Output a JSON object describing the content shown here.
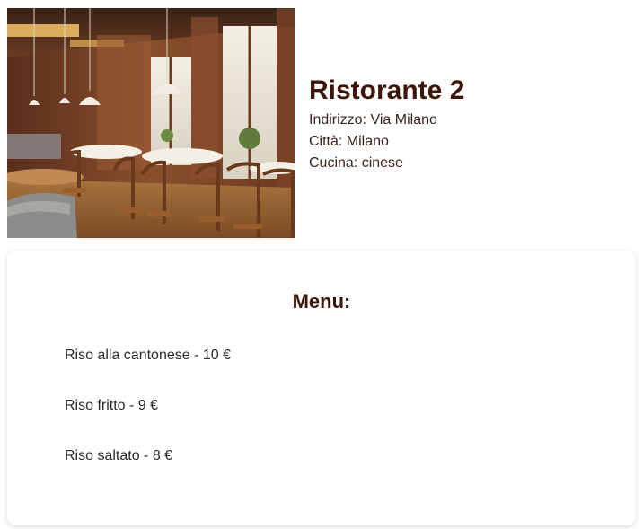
{
  "restaurant": {
    "name": "Ristorante 2",
    "address": "Indirizzo: Via Milano",
    "city": "Città: Milano",
    "cuisine": "Cucina: cinese"
  },
  "menu": {
    "title": "Menu:",
    "items": [
      "Riso alla cantonese - 10 €",
      "Riso fritto - 9 €",
      "Riso saltato - 8 €"
    ]
  },
  "colors": {
    "title": "#3d1608",
    "text": "#2a2a2a"
  }
}
